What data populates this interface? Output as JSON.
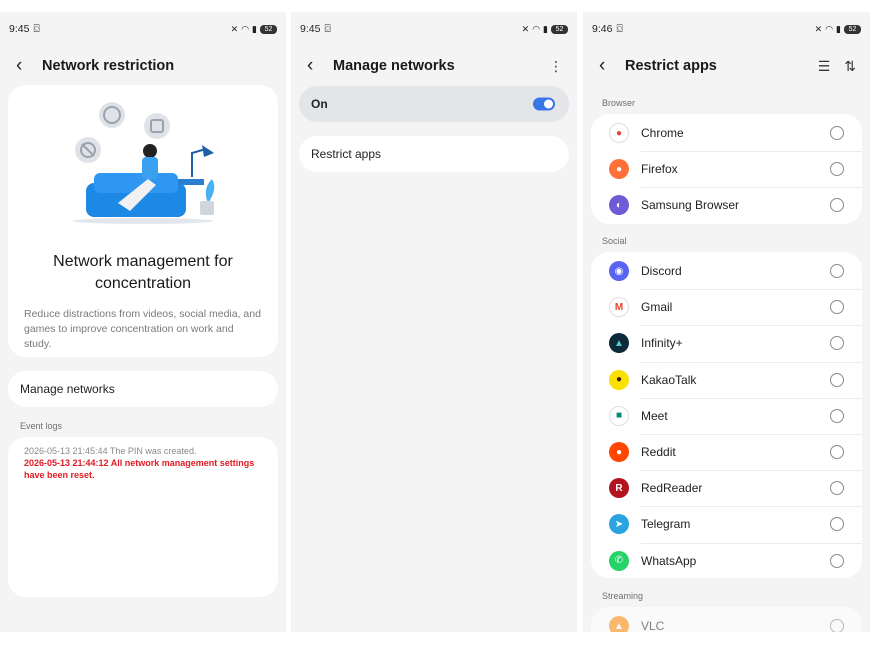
{
  "screen1": {
    "status_time": "9:45",
    "battery": "52",
    "header_title": "Network restriction",
    "hero_title": "Network management for concentration",
    "hero_desc": "Reduce distractions from videos, social media, and games to improve concentration on work and study.",
    "manage_label": "Manage networks",
    "event_logs_label": "Event logs",
    "logs": [
      "2026-05-13 21:45:44 The PIN was created.",
      "2026-05-13 21:44:12 All network management settings have been reset."
    ]
  },
  "screen2": {
    "status_time": "9:45",
    "battery": "52",
    "header_title": "Manage networks",
    "on_label": "On",
    "restrict_label": "Restrict apps"
  },
  "screen3": {
    "status_time": "9:46",
    "battery": "52",
    "header_title": "Restrict apps",
    "sections": {
      "browser": "Browser",
      "social": "Social",
      "streaming": "Streaming"
    },
    "browser_apps": [
      "Chrome",
      "Firefox",
      "Samsung Browser"
    ],
    "social_apps": [
      "Discord",
      "Gmail",
      "Infinity+",
      "KakaoTalk",
      "Meet",
      "Reddit",
      "RedReader",
      "Telegram",
      "WhatsApp"
    ],
    "streaming_apps": [
      "VLC"
    ]
  },
  "colors": {
    "accent": "#3a77e5",
    "alert": "#e11b22"
  }
}
